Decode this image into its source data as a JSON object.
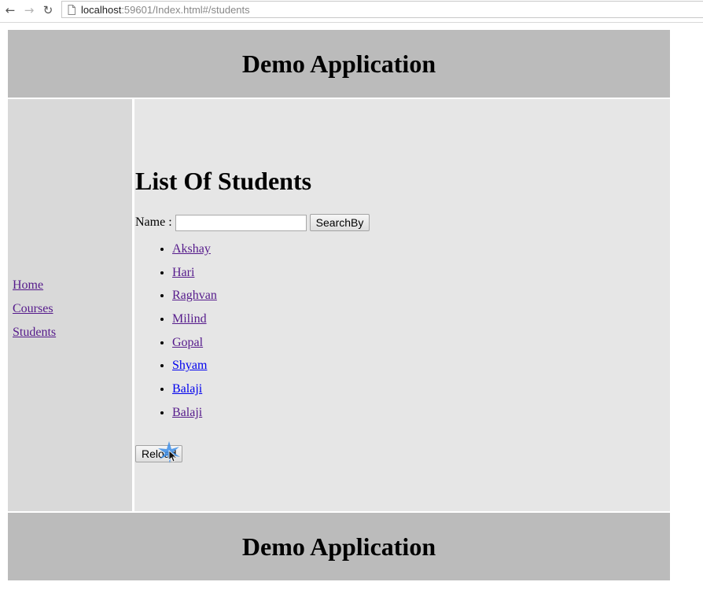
{
  "browser": {
    "url_host": "localhost",
    "url_rest": ":59601/Index.html#/students",
    "back_icon": "back-arrow-icon",
    "forward_icon": "forward-arrow-icon",
    "reload_icon": "reload-icon",
    "page_icon": "page-icon"
  },
  "header": {
    "title": "Demo Application"
  },
  "sidebar": {
    "items": [
      {
        "label": "Home"
      },
      {
        "label": "Courses"
      },
      {
        "label": "Students"
      }
    ]
  },
  "main": {
    "heading": "List Of Students",
    "search": {
      "label": "Name :",
      "value": "",
      "button_label": "SearchBy"
    },
    "students": [
      {
        "name": "Akshay"
      },
      {
        "name": "Hari"
      },
      {
        "name": "Raghvan"
      },
      {
        "name": "Milind"
      },
      {
        "name": "Gopal"
      },
      {
        "name": "Shyam"
      },
      {
        "name": "Balaji"
      },
      {
        "name": "Balaji"
      }
    ],
    "reload_label": "Reload"
  },
  "footer": {
    "title": "Demo Application"
  },
  "colors": {
    "header_bg": "#bbbbbb",
    "sidebar_bg": "#d9d9d9",
    "content_bg": "#e6e6e6",
    "visited_link": "#551a8b",
    "link": "#0000ee"
  }
}
